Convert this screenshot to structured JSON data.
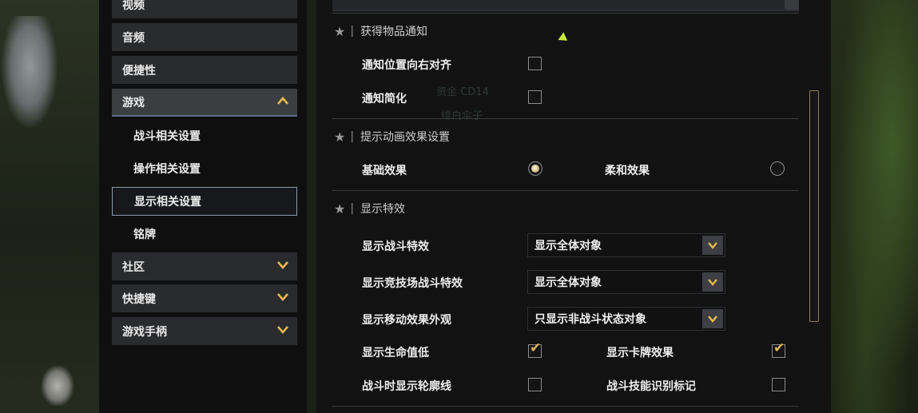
{
  "sidebar": {
    "items": [
      {
        "label": "视频"
      },
      {
        "label": "音频"
      },
      {
        "label": "便捷性"
      },
      {
        "label": "游戏"
      },
      {
        "label": "社区"
      },
      {
        "label": "快捷键"
      },
      {
        "label": "游戏手柄"
      }
    ],
    "sub_items": [
      {
        "label": "战斗相关设置"
      },
      {
        "label": "操作相关设置"
      },
      {
        "label": "显示相关设置"
      },
      {
        "label": "铭牌"
      }
    ],
    "expanded_item": "游戏",
    "selected_sub_item": "显示相关设置"
  },
  "sections": {
    "item_notify": {
      "title": "获得物品通知",
      "opt_align": {
        "label": "通知位置向右对齐",
        "checked": false
      },
      "opt_simple": {
        "label": "通知简化",
        "checked": false
      }
    },
    "anim": {
      "title": "提示动画效果设置",
      "opt_basic": {
        "label": "基础效果",
        "selected": true
      },
      "opt_soft": {
        "label": "柔和效果",
        "selected": false
      }
    },
    "effects": {
      "title": "显示特效",
      "sel_combat": {
        "label": "显示战斗特效",
        "value": "显示全体对象"
      },
      "sel_arena": {
        "label": "显示竞技场战斗特效",
        "value": "显示全体对象"
      },
      "sel_move": {
        "label": "显示移动效果外观",
        "value": "只显示非战斗状态对象"
      },
      "chk_hp": {
        "label": "显示生命值低",
        "checked": true
      },
      "chk_card": {
        "label": "显示卡牌效果",
        "checked": true
      },
      "chk_outline": {
        "label": "战斗时显示轮廓线",
        "checked": false
      },
      "chk_skill": {
        "label": "战斗技能识别标记",
        "checked": false
      }
    }
  },
  "background_ghost_text": [
    "资金 CD14",
    "绯白伞子"
  ],
  "icons": {
    "collapse": "chevron-up-icon",
    "expand": "chevron-down-icon",
    "favorite": "star-icon",
    "check": "checkmark-icon"
  },
  "colors": {
    "accent": "#e8b94a",
    "panel_bg": "#121213",
    "nav_bg": "#2a2b2d"
  }
}
